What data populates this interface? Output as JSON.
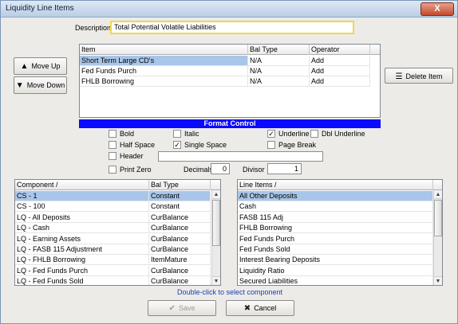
{
  "window": {
    "title": "Liquidity Line Items",
    "close_symbol": "X"
  },
  "description": {
    "label": "Description",
    "value": "Total Potential Volatile Liabilities"
  },
  "buttons": {
    "move_up": {
      "label": "Move Up",
      "icon": "arrow-up-icon",
      "glyph": "▲"
    },
    "move_down": {
      "label": "Move Down",
      "icon": "arrow-down-icon",
      "glyph": "▼"
    },
    "delete_item": {
      "label": "Delete Item",
      "icon": "delete-lines-icon",
      "glyph": "☰"
    },
    "save": {
      "label": "Save",
      "icon": "check-icon",
      "glyph": "✔"
    },
    "cancel": {
      "label": "Cancel",
      "icon": "x-icon",
      "glyph": "✖"
    }
  },
  "items_table": {
    "columns": [
      "Item",
      "Bal Type",
      "Operator"
    ],
    "rows": [
      [
        "Short Term Large CD's",
        "N/A",
        "Add"
      ],
      [
        "Fed Funds Purch",
        "N/A",
        "Add"
      ],
      [
        "FHLB Borrowing",
        "N/A",
        "Add"
      ]
    ]
  },
  "format_control": {
    "title": "Format Control",
    "options": {
      "bold": {
        "label": "Bold",
        "mark": ""
      },
      "italic": {
        "label": "Italic",
        "mark": ""
      },
      "underline": {
        "label": "Underline",
        "mark": "✓"
      },
      "dbl_underline": {
        "label": "Dbl Underline",
        "mark": ""
      },
      "half_space": {
        "label": "Half Space",
        "mark": ""
      },
      "single_space": {
        "label": "Single Space",
        "mark": "✓"
      },
      "page_break": {
        "label": "Page Break",
        "mark": ""
      },
      "header": {
        "label": "Header",
        "mark": ""
      },
      "print_zero": {
        "label": "Print Zero",
        "mark": ""
      }
    },
    "header_text": "",
    "decimals": {
      "label": "Decimals",
      "value": "0"
    },
    "divisor": {
      "label": "Divisor",
      "value": "1"
    }
  },
  "components_table": {
    "columns": [
      "Component /",
      "Bal Type"
    ],
    "rows": [
      [
        "CS - 1",
        "Constant"
      ],
      [
        "CS - 100",
        "Constant"
      ],
      [
        "LQ - All Deposits",
        "CurBalance"
      ],
      [
        "LQ - Cash",
        "CurBalance"
      ],
      [
        "LQ - Earning Assets",
        "CurBalance"
      ],
      [
        "LQ - FASB 115 Adjustment",
        "CurBalance"
      ],
      [
        "LQ - FHLB Borrowing",
        "ItemMature"
      ],
      [
        "LQ - Fed Funds Purch",
        "CurBalance"
      ],
      [
        "LQ - Fed Funds Sold",
        "CurBalance"
      ]
    ],
    "scroll_up": "▲",
    "scroll_down": "▼"
  },
  "line_items_table": {
    "columns": [
      "Line Items /"
    ],
    "rows": [
      "All Other Deposits",
      "Cash",
      "FASB 115 Adj",
      "FHLB Borrowing",
      "Fed Funds Purch",
      "Fed Funds Sold",
      "Interest Bearing Deposits",
      "Liquidity Ratio",
      "Secured Liabilities"
    ],
    "scroll_up": "▲",
    "scroll_down": "▼"
  },
  "hint": "Double-click to select component"
}
